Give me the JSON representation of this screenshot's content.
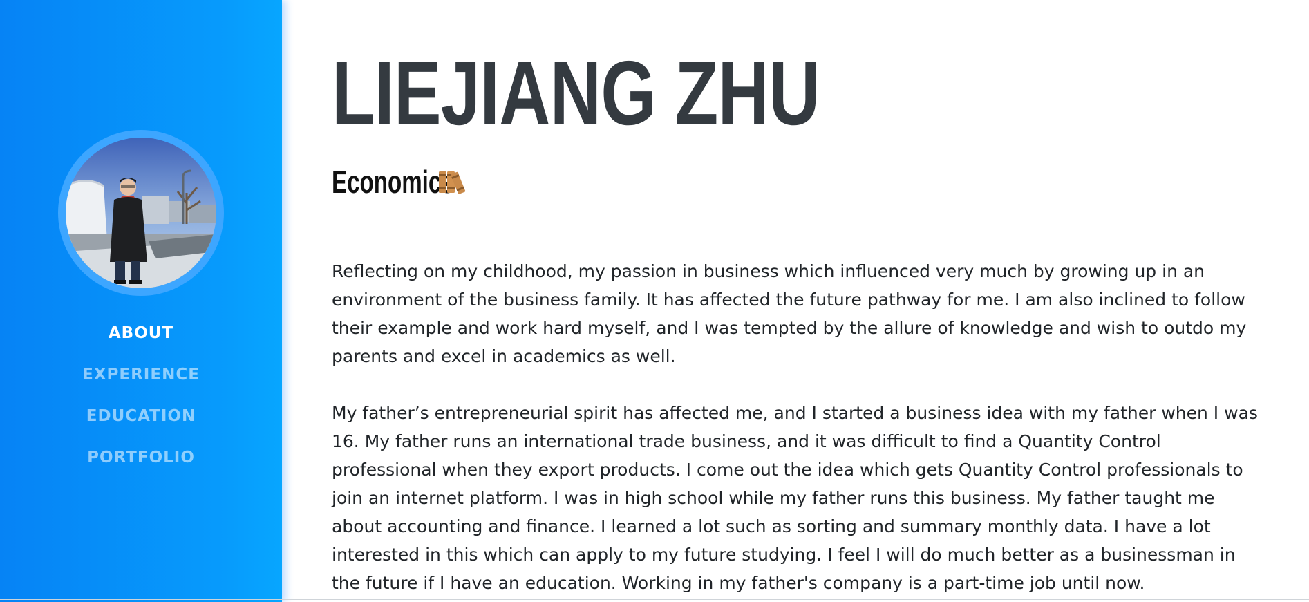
{
  "profile": {
    "name": "LIEJIANG ZHU",
    "subtitle": "Economics"
  },
  "sidebar": {
    "nav": [
      {
        "label": "ABOUT",
        "active": true
      },
      {
        "label": "EXPERIENCE",
        "active": false
      },
      {
        "label": "EDUCATION",
        "active": false
      },
      {
        "label": "PORTFOLIO",
        "active": false
      }
    ]
  },
  "about": {
    "paragraphs": [
      "Reflecting on my childhood, my passion in business which influenced very much by growing up in an environment of the business family. It has affected the future pathway for me. I am also inclined to follow their example and work hard myself, and I was tempted by the allure of knowledge and wish to outdo my parents and excel in academics as well.",
      "My father’s entrepreneurial spirit has affected me, and I started a business idea with my father when I was 16. My father runs an international trade business, and it was difficult to find a Quantity Control professional when they export products. I come out the idea which gets Quantity Control professionals to join an internet platform. I was in high school while my father runs this business. My father taught me about accounting and finance. I learned a lot such as sorting and summary monthly data. I have a lot interested in this which can apply to my future studying. I feel I will do much better as a businessman in the future if I have an education. Working in my father's company is a part-time job until now."
    ]
  },
  "icons": {
    "subtitle_icon": "books-icon"
  },
  "colors": {
    "sidebar_gradient_start": "#0683f5",
    "sidebar_gradient_end": "#07a6ff",
    "heading": "#343a40",
    "body_text": "#212529"
  }
}
